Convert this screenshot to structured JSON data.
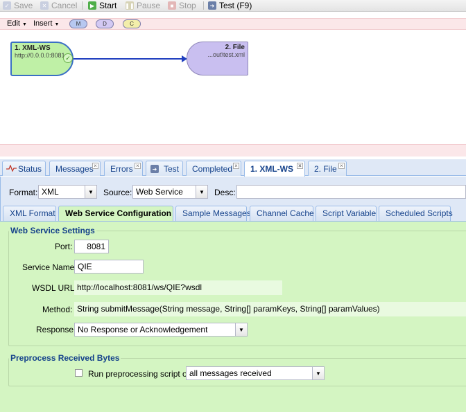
{
  "toolbar": {
    "save": "Save",
    "cancel": "Cancel",
    "start": "Start",
    "pause": "Pause",
    "stop": "Stop",
    "test": "Test (F9)"
  },
  "editbar": {
    "edit": "Edit",
    "insert": "Insert",
    "pills": [
      "M",
      "D",
      "C"
    ]
  },
  "nodes": {
    "n1_title": "1. XML-WS",
    "n1_sub": "http://0.0.0.0:8081",
    "n2_title": "2. File",
    "n2_sub": "...out\\test.xml"
  },
  "tabs": [
    "Status",
    "Messages",
    "Errors",
    "Test",
    "Completed",
    "1. XML-WS",
    "2. File"
  ],
  "form": {
    "format_label": "Format:",
    "format_value": "XML",
    "source_label": "Source:",
    "source_value": "Web Service",
    "desc_label": "Desc:",
    "desc_value": ""
  },
  "subtabs": [
    "XML Format",
    "Web Service Configuration",
    "Sample Messages",
    "Channel Cache",
    "Script Variable",
    "Scheduled Scripts"
  ],
  "ws": {
    "legend": "Web Service Settings",
    "port_label": "Port:",
    "port_value": "8081",
    "service_label": "Service Name:",
    "service_value": "QIE",
    "wsdl_label": "WSDL URL:",
    "wsdl_value": "http://localhost:8081/ws/QIE?wsdl",
    "method_label": "Method:",
    "method_value": "String submitMessage(String message, String[] paramKeys, String[] paramValues)",
    "response_label": "Response:",
    "response_value": "No Response or Acknowledgement"
  },
  "pre": {
    "legend": "Preprocess Received Bytes",
    "check_label": "Run preprocessing script on",
    "check_value": "all messages received"
  },
  "colors": {
    "accent": "#15428b",
    "panel": "#dfe8f6",
    "form_bg": "#d4f5c2"
  }
}
